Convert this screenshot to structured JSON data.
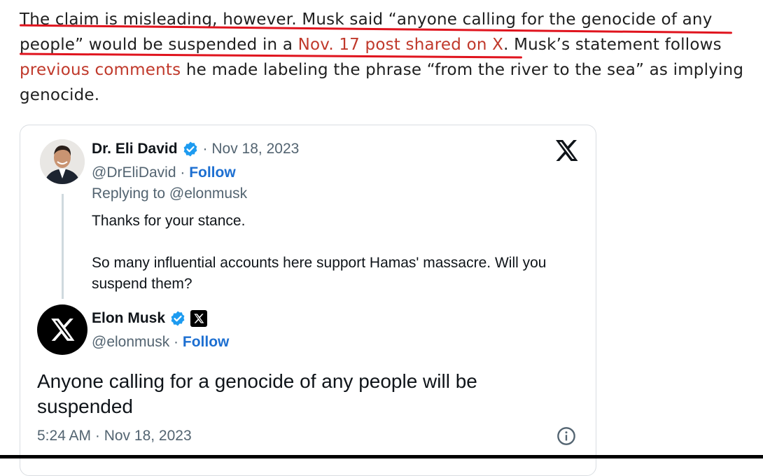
{
  "article": {
    "text_1": "The claim is misleading, however. Musk said “anyone calling for the genocide of any people” would be suspended in a ",
    "link_1": "Nov. 17 post shared on X",
    "text_2": ". Musk’s statement follows ",
    "link_2": "previous comments",
    "text_3": " he made labeling the phrase “from the river to the sea” as implying genocide."
  },
  "embed": {
    "platform_icon": "x-logo-icon",
    "reply": {
      "author_name": "Dr. Eli David",
      "date": "· Nov 18, 2023",
      "handle": "@DrEliDavid ·",
      "follow_label": "Follow",
      "replying_to": "Replying to @elonmusk",
      "body_line_1": "Thanks for your stance.",
      "body_line_2": "So many influential accounts here support Hamas' massacre. Will you suspend them?"
    },
    "main": {
      "author_name": "Elon Musk",
      "handle": "@elonmusk ·",
      "follow_label": "Follow",
      "text": "Anyone calling for a genocide of any people will be suspended",
      "timestamp": "5:24 AM · Nov 18, 2023"
    }
  },
  "colors": {
    "link": "#c0392b",
    "underline": "#e0141e",
    "follow": "#1d6fd1",
    "verified": "#1d9bf0"
  }
}
